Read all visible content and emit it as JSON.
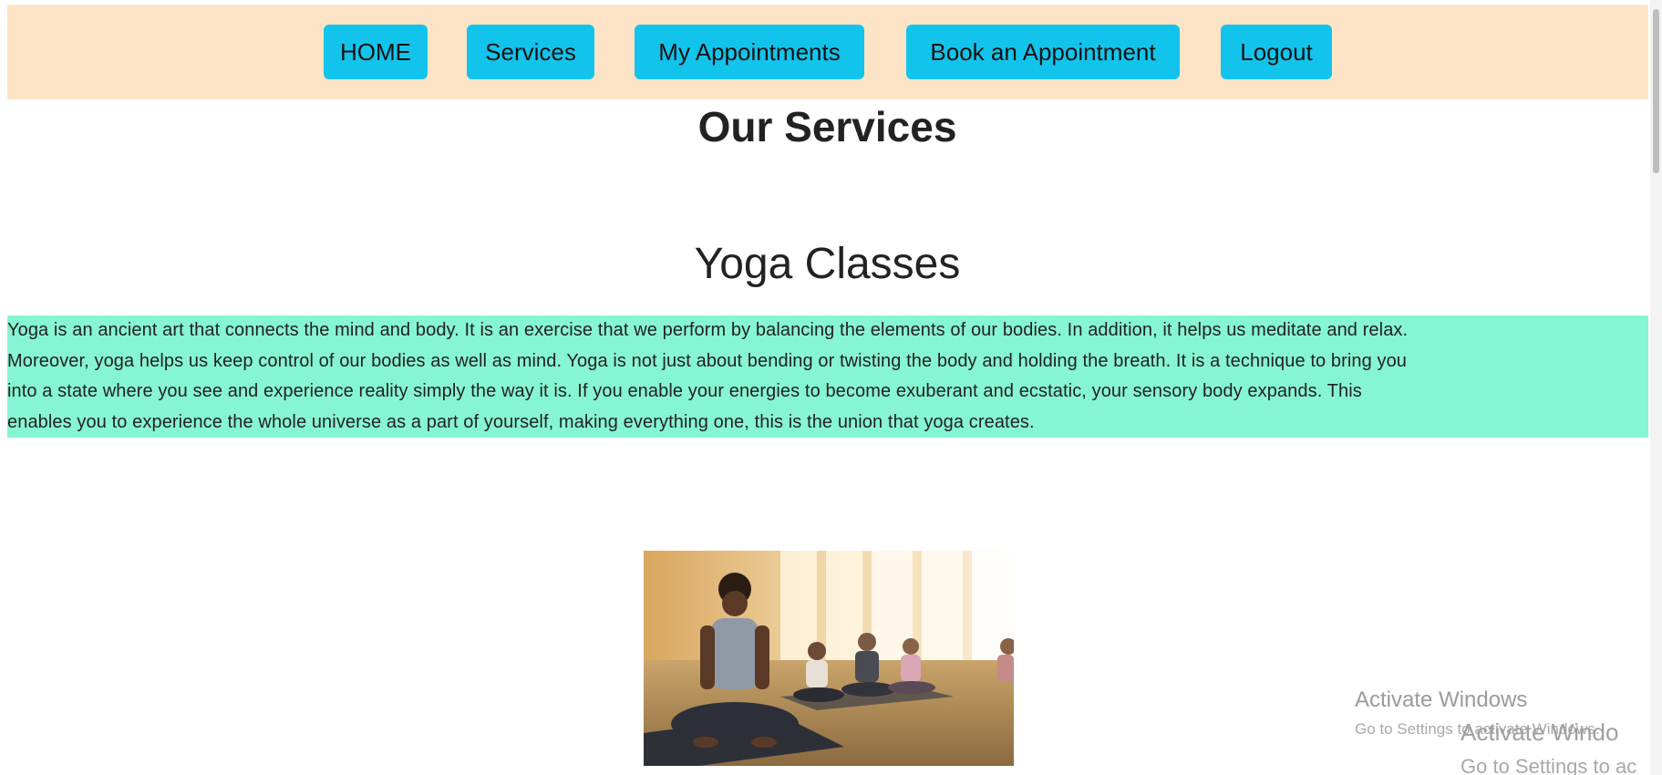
{
  "nav": {
    "items": [
      {
        "label": "HOME"
      },
      {
        "label": "Services"
      },
      {
        "label": "My Appointments"
      },
      {
        "label": "Book an Appointment"
      },
      {
        "label": "Logout"
      }
    ]
  },
  "page": {
    "title": "Our Services"
  },
  "service": {
    "title": "Yoga Classes",
    "description_lines": [
      "Yoga is an ancient art that connects the mind and body. It is an exercise that we perform by balancing the elements of our bodies. In addition, it helps us meditate and relax.",
      "Moreover, yoga helps us keep control of our bodies as well as mind. Yoga is not just about bending or twisting the body and holding the breath. It is a technique to bring you",
      "into a state where you see and experience reality simply the way it is. If you enable your energies to become exuberant and ecstatic, your sensory body expands. This",
      "enables you to experience the whole universe as a part of yourself, making everything one, this is the union that yoga creates."
    ]
  },
  "watermark": {
    "title": "Activate Windows",
    "subtitle": "Go to Settings to activate Windows.",
    "ghost_title": "Activate Windo",
    "ghost_subtitle": "Go to Settings to ac"
  },
  "colors": {
    "navbar_bg": "#fde4c6",
    "nav_button": "#12c4ec",
    "description_bg": "#86f5d3"
  }
}
